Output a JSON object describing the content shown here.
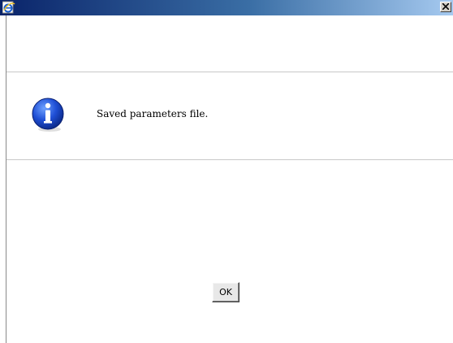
{
  "window": {
    "app_icon": "internet-explorer-icon",
    "close_glyph": "×"
  },
  "dialog": {
    "icon": "info-icon",
    "message": "Saved parameters file.",
    "ok_label": "OK"
  },
  "colors": {
    "titlebar_start": "#0a246a",
    "titlebar_end": "#a6caf0",
    "info_blue": "#1f4fd6",
    "divider": "#c8c8c8"
  }
}
